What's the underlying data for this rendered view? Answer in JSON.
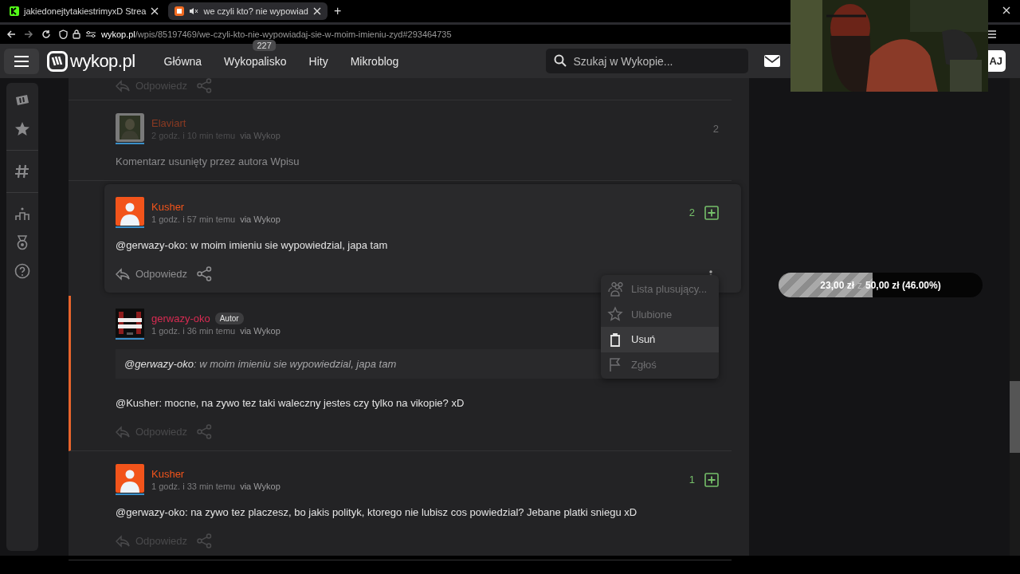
{
  "browser": {
    "tabs": [
      {
        "title": "jakiedonejtytakiestrimyxD Strea",
        "selected": false,
        "muted": false
      },
      {
        "title": "we czyli kto? nie wypowiad",
        "selected": true,
        "muted": true
      }
    ],
    "new_tab": "+",
    "url": {
      "host": "wykop.pl",
      "path": "/wpis/85197469/we-czyli-kto-nie-wypowiadaj-sie-w-moim-imieniu-zyd#293464735"
    }
  },
  "site": {
    "logo": "wykop.pl",
    "nav": [
      {
        "label": "Główna"
      },
      {
        "label": "Wykopalisko",
        "badge": "227"
      },
      {
        "label": "Hity"
      },
      {
        "label": "Mikroblog"
      }
    ],
    "search": {
      "placeholder": "Szukaj w Wykopie..."
    },
    "user_button": "AJ"
  },
  "comments": [
    {
      "kind": "actions",
      "reply": "Odpowiedz"
    },
    {
      "kind": "comment",
      "author": "Elaviart",
      "time": "2 godz. i 10 min temu",
      "via": "via Wykop",
      "votes": "2",
      "can_vote": false,
      "deleted": true,
      "body_text": "Komentarz usunięty przez autora Wpisu"
    },
    {
      "kind": "comment",
      "author": "Kusher",
      "time": "1 godz. i 57 min temu",
      "via": "via Wykop",
      "votes": "2",
      "can_vote": true,
      "active": true,
      "mention": "@gerwazy-oko",
      "body_text": ": w moim imieniu sie wypowiedzial, japa tam",
      "reply": "Odpowiedz",
      "menu": [
        {
          "label": "Lista plusujący...",
          "selected": false
        },
        {
          "label": "Ulubione",
          "selected": false
        },
        {
          "label": "Usuń",
          "selected": true
        },
        {
          "label": "Zgłoś",
          "selected": false
        }
      ]
    },
    {
      "kind": "comment",
      "author": "gerwazy-oko",
      "badge": "Autor",
      "time": "1 godz. i 36 min temu",
      "via": "via Wykop",
      "highlighted": true,
      "quote_mention": "@gerwazy-oko",
      "quote_text": ": w moim imieniu sie wypowiedzial, japa tam",
      "mention": "@Kusher",
      "body_text": ": mocne, na zywo tez taki waleczny jestes czy tylko na vikopie? xD",
      "reply": "Odpowiedz"
    },
    {
      "kind": "comment",
      "author": "Kusher",
      "time": "1 godz. i 33 min temu",
      "via": "via Wykop",
      "votes": "1",
      "can_vote": true,
      "mention": "@gerwazy-oko",
      "body_text": ": na zywo tez placzesz, bo jakis polityk, ktorego nie lubisz cos powiedzial? Jebane platki sniegu xD",
      "reply": "Odpowiedz"
    }
  ],
  "goal": {
    "raised": "23,00 zł",
    "sep": "z",
    "target": "50,00 zł (46.00%)",
    "level": 0.46
  }
}
